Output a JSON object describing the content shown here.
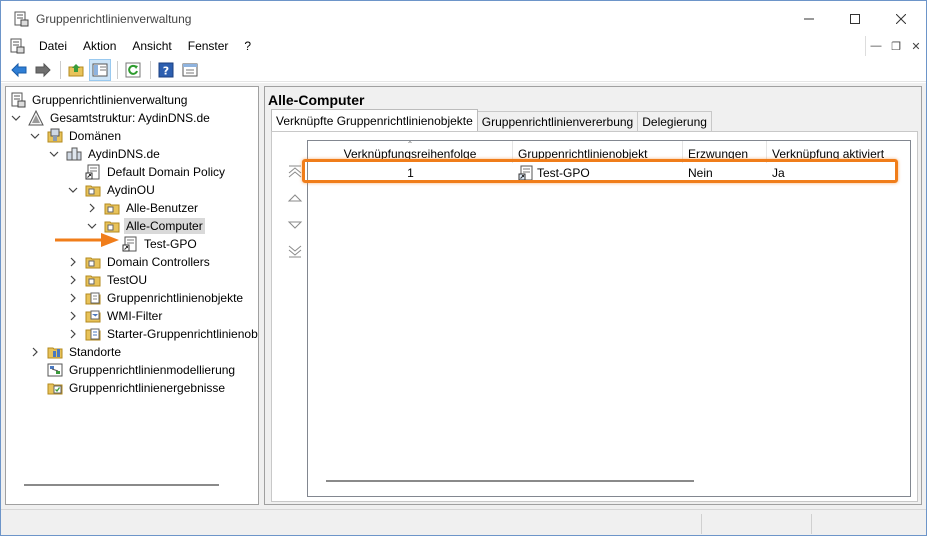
{
  "window": {
    "title": "Gruppenrichtlinienverwaltung",
    "icon": "gpmc-app-icon",
    "controls": [
      "minimize",
      "maximize",
      "close"
    ]
  },
  "menubar": {
    "items": [
      "Datei",
      "Aktion",
      "Ansicht",
      "Fenster",
      "?"
    ]
  },
  "toolbar": {
    "buttons": [
      "back-arrow-icon",
      "forward-arrow-icon",
      "up-folder-icon",
      "show-hide-tree-icon",
      "refresh-icon",
      "help-icon",
      "properties-icon"
    ]
  },
  "tree": {
    "nodes": [
      {
        "label": "Gruppenrichtlinienverwaltung",
        "icon": "gpmc-icon"
      },
      {
        "label": "Gesamtstruktur: AydinDNS.de",
        "icon": "forest-icon"
      },
      {
        "label": "Domänen",
        "icon": "domains-icon"
      },
      {
        "label": "AydinDNS.de",
        "icon": "domain-icon"
      },
      {
        "label": "Default Domain Policy",
        "icon": "gpo-link-icon"
      },
      {
        "label": "AydinOU",
        "icon": "ou-icon"
      },
      {
        "label": "Alle-Benutzer",
        "icon": "ou-icon"
      },
      {
        "label": "Alle-Computer",
        "icon": "ou-icon"
      },
      {
        "label": "Test-GPO",
        "icon": "gpo-link-icon"
      },
      {
        "label": "Domain Controllers",
        "icon": "ou-icon"
      },
      {
        "label": "TestOU",
        "icon": "ou-icon"
      },
      {
        "label": "Gruppenrichtlinienobjekte",
        "icon": "gpo-folder-icon"
      },
      {
        "label": "WMI-Filter",
        "icon": "wmi-folder-icon"
      },
      {
        "label": "Starter-Gruppenrichtlinienob",
        "icon": "starter-folder-icon"
      },
      {
        "label": "Standorte",
        "icon": "sites-icon"
      },
      {
        "label": "Gruppenrichtlinienmodellierung",
        "icon": "modeling-icon"
      },
      {
        "label": "Gruppenrichtlinienergebnisse",
        "icon": "results-icon"
      }
    ],
    "selected": "Alle-Computer"
  },
  "right_pane": {
    "title": "Alle-Computer",
    "tabs": [
      "Verknüpfte Gruppenrichtlinienobjekte",
      "Gruppenrichtlinienvererbung",
      "Delegierung"
    ],
    "active_tab": "Verknüpfte Gruppenrichtlinienobjekte",
    "order_buttons": [
      "move-to-top-icon",
      "move-up-icon",
      "move-down-icon",
      "move-to-bottom-icon"
    ],
    "columns": [
      "Verknüpfungsreihenfolge",
      "Gruppenrichtlinienobjekt",
      "Erzwungen",
      "Verknüpfung aktiviert"
    ],
    "rows": [
      {
        "order": "1",
        "gpo": "Test-GPO",
        "enforced": "Nein",
        "link_enabled": "Ja"
      }
    ]
  },
  "colors": {
    "highlight_orange": "#f07d1a",
    "selection_gray": "#d9d9d9",
    "window_border": "#6d95c9"
  }
}
